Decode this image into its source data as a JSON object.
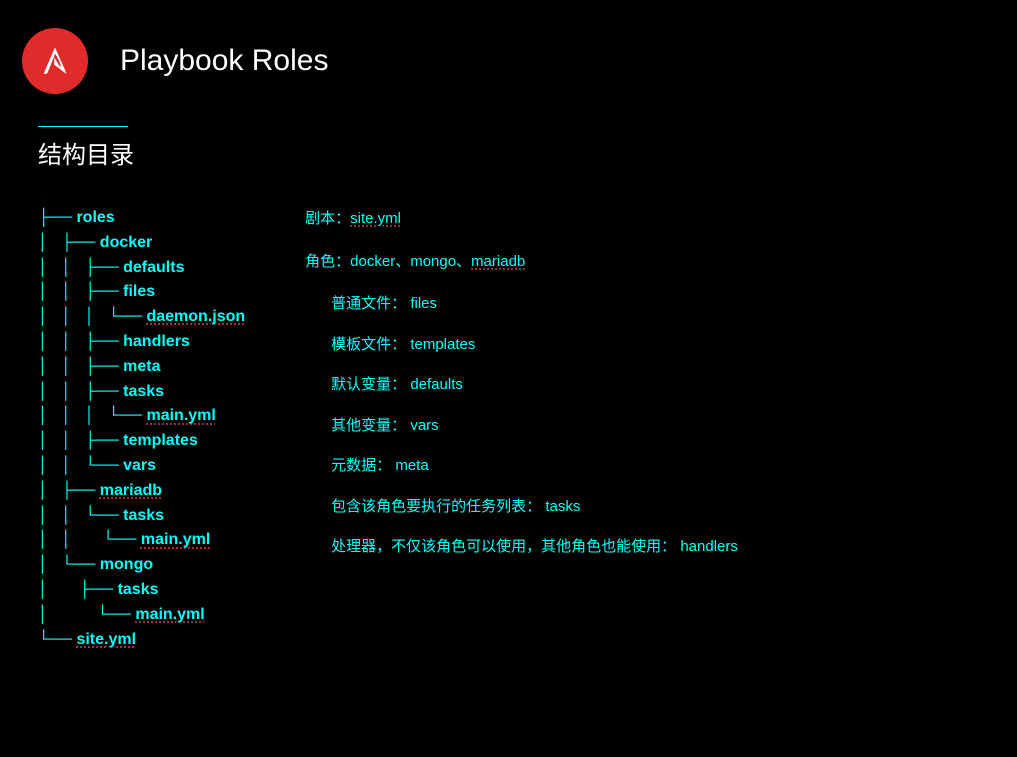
{
  "header": {
    "title": "Playbook Roles",
    "subtitle": "结构目录"
  },
  "tree": {
    "l0": "├── roles",
    "l1": "│   ├── docker",
    "l2": "│   │   ├── defaults",
    "l3": "│   │   ├── files",
    "l4p": "│   │   │   └── ",
    "l4u": "daemon.json",
    "l5": "│   │   ├── handlers",
    "l6": "│   │   ├── meta",
    "l7": "│   │   ├── tasks",
    "l8p": "│   │   │   └── ",
    "l8u": "main.yml",
    "l9": "│   │   ├── templates",
    "l10": "│   │   └── vars",
    "l11p": "│   ├── ",
    "l11u": "mariadb",
    "l12": "│   │   └── tasks",
    "l13p": "│   │       └── ",
    "l13u": "main.yml",
    "l14": "│   └── mongo",
    "l15": "│       ├── tasks",
    "l16p": "│           └── ",
    "l16u": "main.yml",
    "l17p": "└── ",
    "l17u": "site.yml"
  },
  "desc": {
    "playbook_label": "剧本：",
    "playbook_value": "site.yml",
    "roles_label": "角色：",
    "roles_part1": "docker、mongo、",
    "roles_part2": "mariadb",
    "files": "普通文件： files",
    "templates": "模板文件： templates",
    "defaults": "默认变量： defaults",
    "vars": "其他变量： vars",
    "meta": "元数据： meta",
    "tasks": "包含该角色要执行的任务列表： tasks",
    "handlers": "处理器，不仅该角色可以使用，其他角色也能使用： handlers"
  }
}
